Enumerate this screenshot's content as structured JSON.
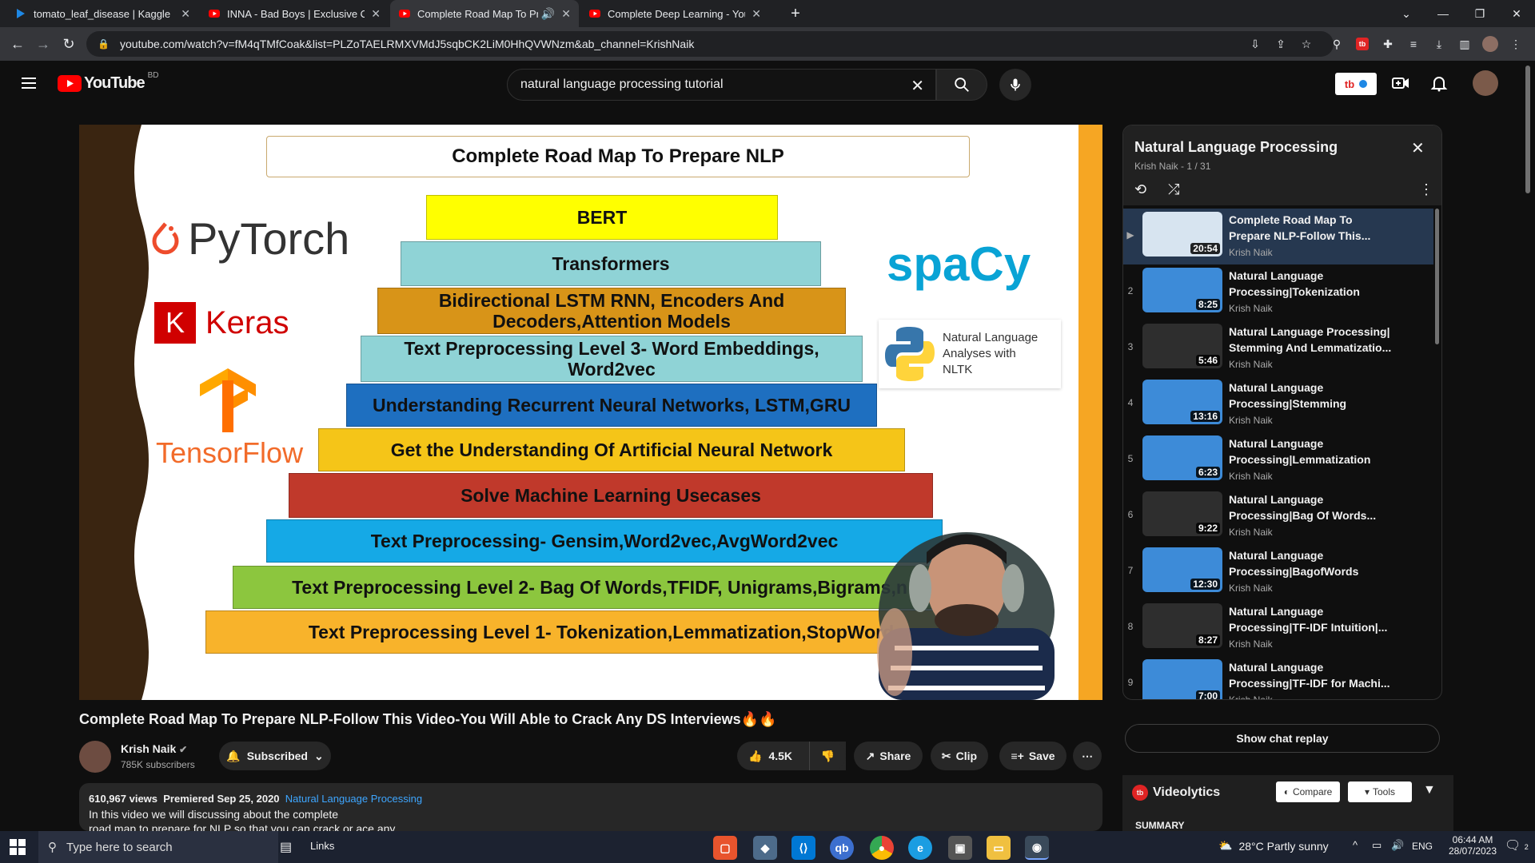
{
  "browser": {
    "tabs": [
      {
        "title": "tomato_leaf_disease | Kaggle",
        "favicon": "kaggle-icon"
      },
      {
        "title": "INNA - Bad Boys | Exclusive Onlin",
        "favicon": "youtube-icon"
      },
      {
        "title": "Complete Road Map To Prep",
        "favicon": "youtube-icon",
        "active": true
      },
      {
        "title": "Complete Deep Learning - YouTu",
        "favicon": "youtube-icon"
      }
    ],
    "url": "youtube.com/watch?v=fM4qTMfCoak&list=PLZoTAELRMXVMdJ5sqbCK2LiM0HhQVWNzm&ab_channel=KrishNaik"
  },
  "youtube": {
    "logo": "YouTube",
    "country": "BD",
    "search_value": "natural language processing tutorial"
  },
  "video": {
    "slide_title": "Complete Road Map To Prepare NLP",
    "logos": [
      "PyTorch",
      "Keras",
      "TensorFlow",
      "spaCy"
    ],
    "nltk_label": "Natural Language Analyses with NLTK",
    "levels": [
      {
        "text": "BERT",
        "color": "#ffff00"
      },
      {
        "text": "Transformers",
        "color": "#8fd3d6"
      },
      {
        "text": "Bidirectional LSTM RNN, Encoders And Decoders,Attention Models",
        "color": "#d89418"
      },
      {
        "text": "Text Preprocessing Level 3- Word Embeddings, Word2vec",
        "color": "#8fd3d6"
      },
      {
        "text": "Understanding Recurrent Neural Networks, LSTM,GRU",
        "color": "#1e6fc0"
      },
      {
        "text": "Get the Understanding Of Artificial Neural Network",
        "color": "#f5c518"
      },
      {
        "text": "Solve Machine Learning Usecases",
        "color": "#c0392b"
      },
      {
        "text": "Text Preprocessing- Gensim,Word2vec,AvgWord2vec",
        "color": "#15a9e6"
      },
      {
        "text": "Text Preprocessing Level 2- Bag Of Words,TFIDF, Unigrams,Bigrams,n",
        "color": "#8cc63e"
      },
      {
        "text": "Text Preprocessing Level 1- Tokenization,Lemmatization,StopWord",
        "color": "#f8b32b"
      }
    ],
    "title": "Complete Road Map To Prepare NLP-Follow This Video-You Will Able to Crack Any DS Interviews🔥🔥",
    "channel": "Krish Naik",
    "subscribers": "785K subscribers",
    "subscribed_label": "Subscribed",
    "likes": "4.5K",
    "share_label": "Share",
    "clip_label": "Clip",
    "save_label": "Save",
    "views": "610,967 views",
    "premiered": "Premiered Sep 25, 2020",
    "playlist_link": "Natural Language Processing",
    "description": "In this video we will discussing about the complete",
    "description2": "road map to prepare for NLP so that you can crack or ace any"
  },
  "playlist": {
    "title": "Natural Language Processing",
    "meta": "Krish Naik - 1 / 31",
    "items": [
      {
        "num": "▶",
        "title": "Complete Road Map To Prepare NLP-Follow This...",
        "channel": "Krish Naik",
        "duration": "20:54"
      },
      {
        "num": "2",
        "title": "Natural Language Processing|Tokenization",
        "channel": "Krish Naik",
        "duration": "8:25"
      },
      {
        "num": "3",
        "title": "Natural Language Processing| Stemming And Lemmatizatio...",
        "channel": "Krish Naik",
        "duration": "5:46"
      },
      {
        "num": "4",
        "title": "Natural Language Processing|Stemming",
        "channel": "Krish Naik",
        "duration": "13:16"
      },
      {
        "num": "5",
        "title": "Natural Language Processing|Lemmatization",
        "channel": "Krish Naik",
        "duration": "6:23"
      },
      {
        "num": "6",
        "title": "Natural Language Processing|Bag Of Words...",
        "channel": "Krish Naik",
        "duration": "9:22"
      },
      {
        "num": "7",
        "title": "Natural Language Processing|BagofWords",
        "channel": "Krish Naik",
        "duration": "12:30"
      },
      {
        "num": "8",
        "title": "Natural Language Processing|TF-IDF Intuition|...",
        "channel": "Krish Naik",
        "duration": "8:27"
      },
      {
        "num": "9",
        "title": "Natural Language Processing|TF-IDF for Machi...",
        "channel": "Krish Naik",
        "duration": "7:00"
      }
    ]
  },
  "chat_replay_label": "Show chat replay",
  "videolytics": {
    "name": "Videolytics",
    "compare": "Compare",
    "tools": "Tools",
    "summary": "SUMMARY"
  },
  "taskbar": {
    "search_placeholder": "Type here to search",
    "links": "Links",
    "weather": "28°C  Partly sunny",
    "lang": "ENG",
    "time": "06:44 AM",
    "date": "28/07/2023",
    "notif_count": "2"
  }
}
